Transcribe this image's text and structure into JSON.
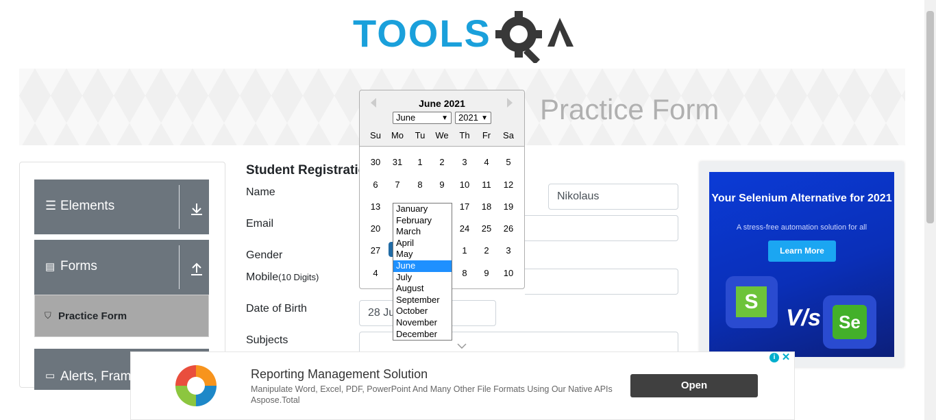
{
  "header": {
    "logo_text": "TOOLSQA",
    "banner_title": "Practice Form"
  },
  "sidebar": {
    "groups": [
      {
        "label": "Elements",
        "icon": "hamburger-icon",
        "arrow": "download-arrow-icon"
      },
      {
        "label": "Forms",
        "icon": "document-icon",
        "arrow": "upload-arrow-icon"
      },
      {
        "label": "Alerts, Frame & Windows",
        "icon": "window-icon"
      }
    ],
    "active_item": {
      "label": "Practice Form",
      "icon": "html5-shield-icon"
    }
  },
  "form": {
    "title": "Student Registration Form",
    "name_label": "Name",
    "last_name_value": "Nikolaus",
    "email_label": "Email",
    "gender_label": "Gender",
    "mobile_label": "Mobile",
    "mobile_hint": "(10 Digits)",
    "dob_label": "Date of Birth",
    "dob_value": "28 Jun 2021",
    "subjects_label": "Subjects"
  },
  "datepicker": {
    "title": "June 2021",
    "month_select": "June",
    "year_select": "2021",
    "weekdays": [
      "Su",
      "Mo",
      "Tu",
      "We",
      "Th",
      "Fr",
      "Sa"
    ],
    "weeks": [
      [
        "30",
        "31",
        "1",
        "2",
        "3",
        "4",
        "5"
      ],
      [
        "6",
        "7",
        "8",
        "9",
        "10",
        "11",
        "12"
      ],
      [
        "13",
        "",
        "",
        "",
        "17",
        "18",
        "19"
      ],
      [
        "20",
        "",
        "",
        "",
        "24",
        "25",
        "26"
      ],
      [
        "27",
        "",
        "",
        "",
        "1",
        "2",
        "3"
      ],
      [
        "4",
        "",
        "",
        "",
        "8",
        "9",
        "10"
      ]
    ],
    "months_dropdown": [
      "January",
      "February",
      "March",
      "April",
      "May",
      "June",
      "July",
      "August",
      "September",
      "October",
      "November",
      "December"
    ],
    "highlighted_month": "June"
  },
  "ad_right": {
    "headline": "Your Selenium Alternative for 2021",
    "subtext": "A stress-free automation solution for all",
    "cta": "Learn More",
    "vs_text": "V/s",
    "left_logo_letter": "S",
    "right_logo_letters": "Se"
  },
  "ad_bottom": {
    "title": "Reporting Management Solution",
    "description": "Manipulate Word, Excel, PDF, PowerPoint And Many Other File Formats Using Our Native APIs Aspose.Total",
    "cta": "Open",
    "info_glyph": "i",
    "close_glyph": "✕"
  },
  "colors": {
    "brand_blue": "#1aa0db",
    "brand_dark": "#383838",
    "sidebar_group": "#6c757d",
    "selected_day": "#216ba5",
    "dropdown_highlight": "#1e90ff"
  }
}
